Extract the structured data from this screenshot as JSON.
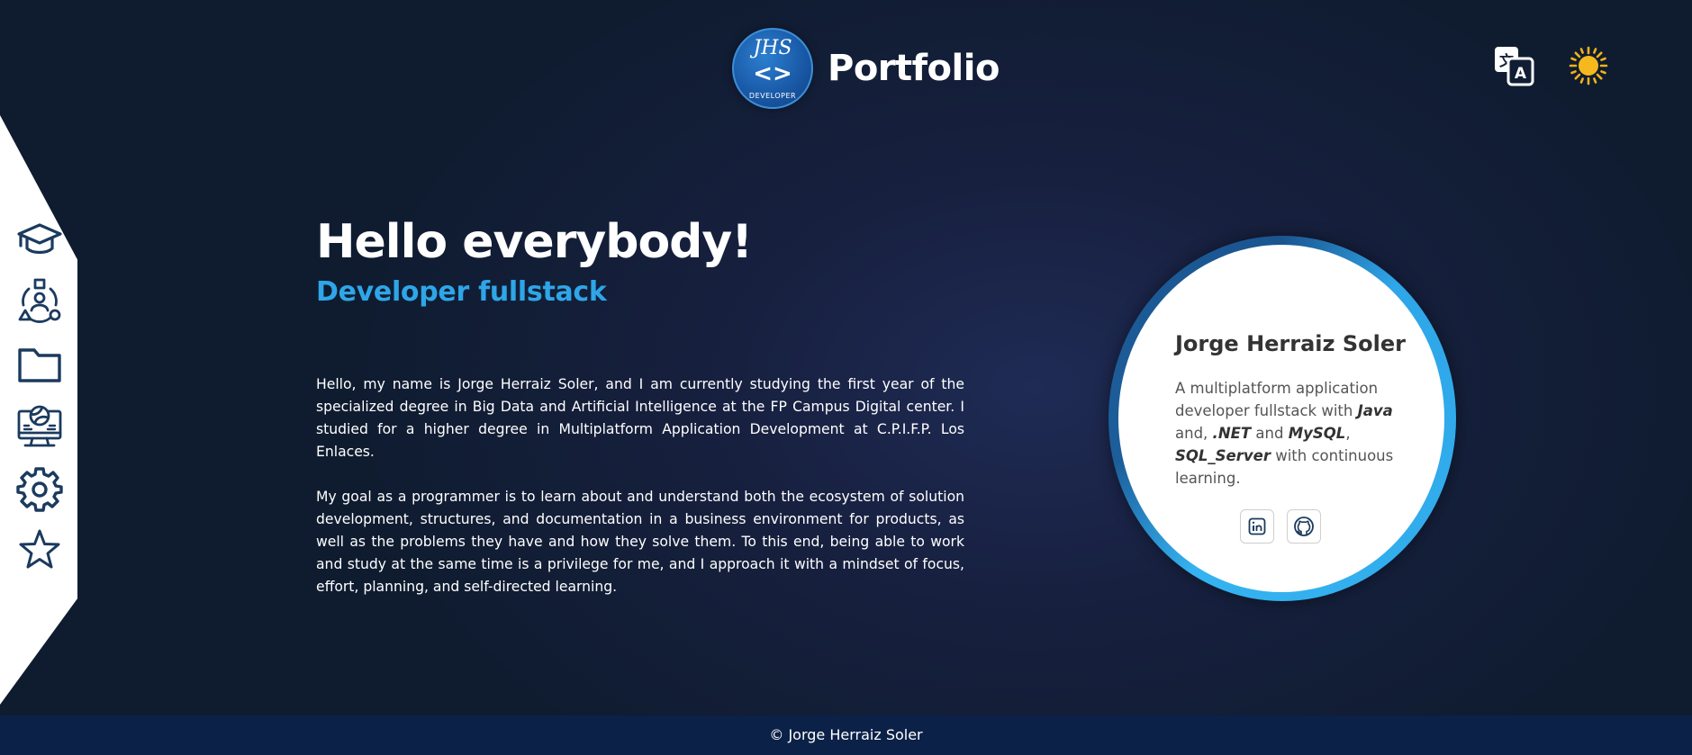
{
  "header": {
    "logo": {
      "top_text": "JHS",
      "middle_text": "<>",
      "bottom_text": "DEVELOPER"
    },
    "title": "Portfolio",
    "translate_icon": "translate-icon",
    "theme_icon": "sun-icon"
  },
  "sidebar": {
    "items": [
      {
        "name": "education",
        "icon": "graduation-cap-icon"
      },
      {
        "name": "skills",
        "icon": "network-people-icon"
      },
      {
        "name": "projects",
        "icon": "folder-icon"
      },
      {
        "name": "courses",
        "icon": "computer-volleyball-icon"
      },
      {
        "name": "settings",
        "icon": "gear-icon"
      },
      {
        "name": "favorites",
        "icon": "star-icon"
      }
    ]
  },
  "hero": {
    "greeting": "Hello everybody!",
    "role": "Developer fullstack",
    "paragraph1": "Hello, my name is Jorge Herraiz Soler, and I am currently studying the first year of the specialized degree in Big Data and Artificial Intelligence at the FP Campus Digital center. I studied for a higher degree in Multiplatform Application Development at C.P.I.F.P. Los Enlaces.",
    "paragraph2": "My goal as a programmer is to learn about and understand both the ecosystem of solution development, structures, and documentation in a business environment for products, as well as the problems they have and how they solve them. To this end, being able to work and study at the same time is a privilege for me, and I approach it with a mindset of focus, effort, planning, and self-directed learning."
  },
  "card": {
    "name": "Jorge Herraiz Soler",
    "desc_part1": "A multiplatform application developer fullstack with ",
    "tech1": "Java",
    "desc_part2": " and, ",
    "tech2": ".NET",
    "desc_part3": " and ",
    "tech3": "MySQL",
    "desc_part4": ", ",
    "tech4": "SQL_Server",
    "desc_part5": " with continuous learning.",
    "social": [
      {
        "name": "linkedin",
        "icon": "linkedin-icon"
      },
      {
        "name": "github",
        "icon": "github-icon"
      }
    ]
  },
  "colors": {
    "background": "#111d33",
    "accent": "#2ea6e8",
    "sidebar_icon": "#1b3a5e",
    "footer": "#0b2148",
    "sun": "#f0b21b"
  },
  "footer": {
    "text": "© Jorge Herraiz Soler"
  }
}
